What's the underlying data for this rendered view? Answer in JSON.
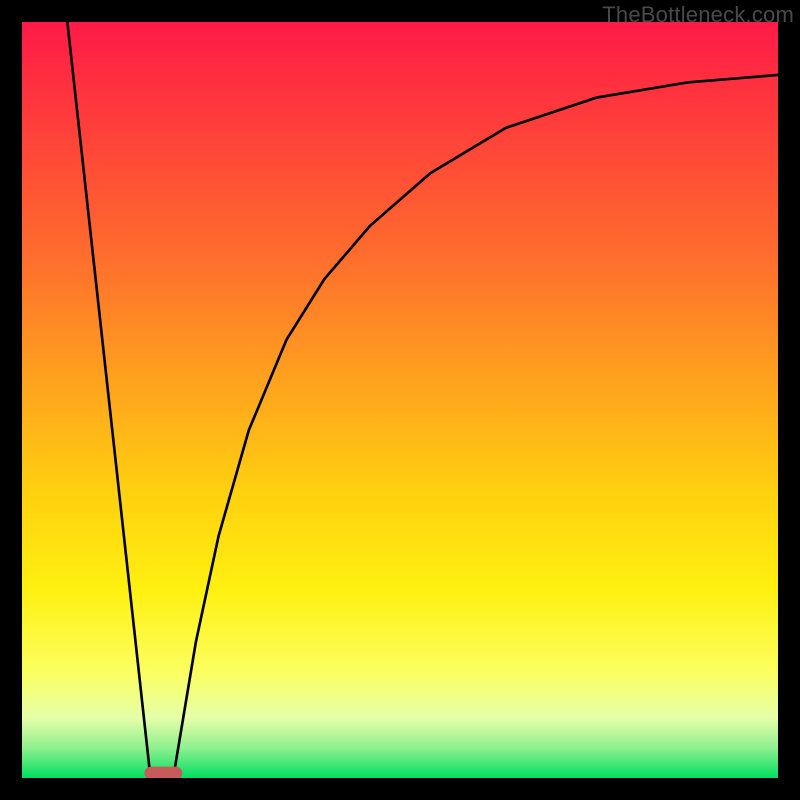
{
  "watermark": "TheBottleneck.com",
  "chart_data": {
    "type": "line",
    "title": "",
    "xlabel": "",
    "ylabel": "",
    "xlim": [
      0,
      100
    ],
    "ylim": [
      0,
      100
    ],
    "grid": false,
    "legend": false,
    "background_gradient": {
      "direction": "vertical",
      "stops": [
        {
          "pos": 0,
          "color": "#ff1a47"
        },
        {
          "pos": 30,
          "color": "#ff6a2e"
        },
        {
          "pos": 62,
          "color": "#ffd010"
        },
        {
          "pos": 86,
          "color": "#fcff60"
        },
        {
          "pos": 96,
          "color": "#90f090"
        },
        {
          "pos": 100,
          "color": "#00e060"
        }
      ]
    },
    "series": [
      {
        "name": "left-slope",
        "x": [
          6,
          17
        ],
        "y": [
          100,
          0
        ]
      },
      {
        "name": "right-curve",
        "x": [
          20,
          23,
          26,
          30,
          35,
          40,
          46,
          54,
          64,
          76,
          88,
          100
        ],
        "y": [
          0,
          18,
          32,
          46,
          58,
          66,
          73,
          80,
          86,
          90,
          92,
          93
        ]
      }
    ],
    "valley_marker": {
      "x_range": [
        17,
        20
      ],
      "y": 0,
      "color": "#c95a5a"
    }
  }
}
